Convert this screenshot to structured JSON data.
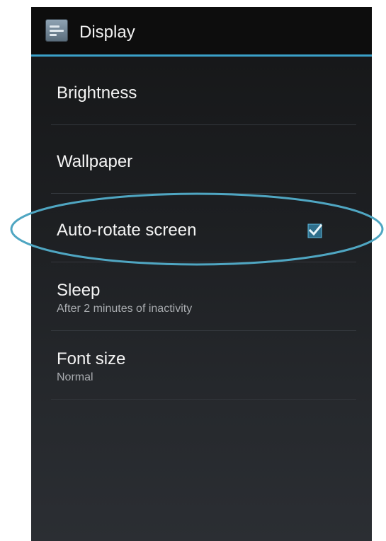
{
  "action_bar": {
    "title": "Display",
    "icon": "settings-display-icon"
  },
  "preferences": [
    {
      "title": "Brightness"
    },
    {
      "title": "Wallpaper"
    },
    {
      "title": "Auto-rotate screen",
      "checked": true
    },
    {
      "title": "Sleep",
      "summary": "After 2 minutes of inactivity"
    },
    {
      "title": "Font size",
      "summary": "Normal"
    }
  ],
  "colors": {
    "accent": "#3aa0c8",
    "checkbox_fill": "#38a3d1",
    "highlight_ring": "#4fa6c2"
  }
}
